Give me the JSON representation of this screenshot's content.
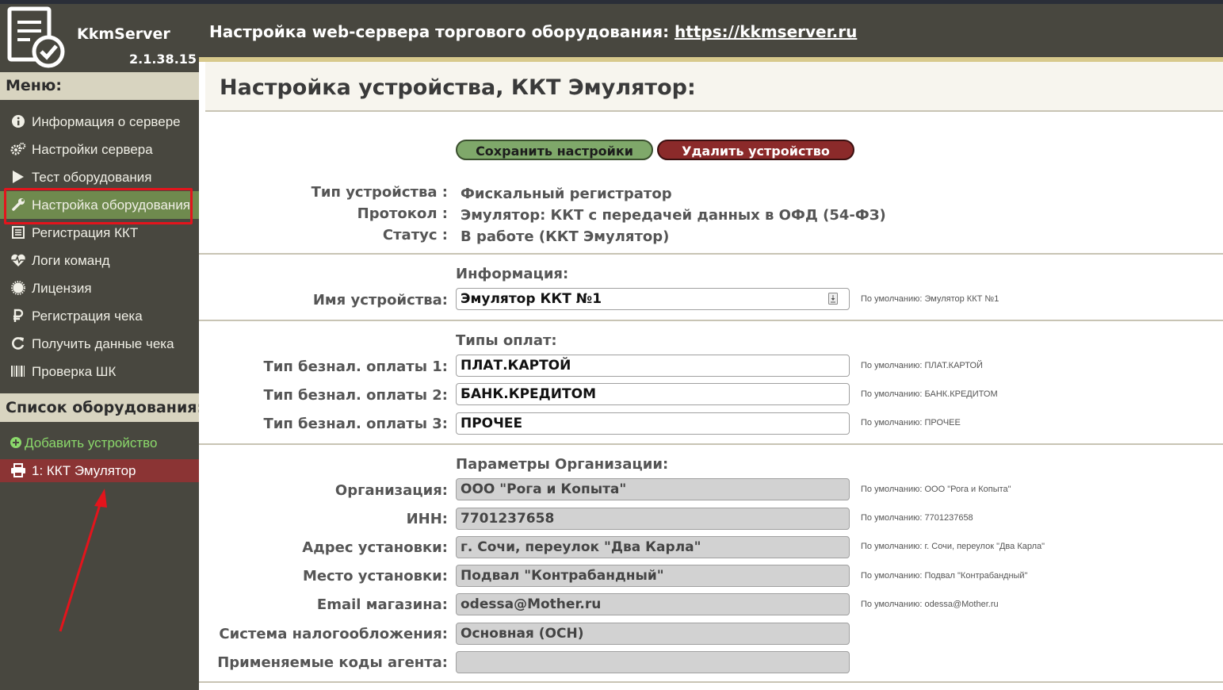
{
  "app": {
    "name": "KkmServer",
    "version": "2.1.38.15"
  },
  "header": {
    "title": "Настройка web-сервера торгового оборудования: ",
    "link": "https://kkmserver.ru"
  },
  "sidebar": {
    "menu_header": "Меню:",
    "items": [
      {
        "label": "Информация о сервере",
        "icon": "info-icon"
      },
      {
        "label": "Настройки сервера",
        "icon": "gears-icon"
      },
      {
        "label": "Тест оборудования",
        "icon": "play-icon"
      },
      {
        "label": "Настройка оборудования",
        "icon": "wrench-icon"
      },
      {
        "label": "Регистрация ККТ",
        "icon": "list-icon"
      },
      {
        "label": "Логи команд",
        "icon": "heartbeat-icon"
      },
      {
        "label": "Лицензия",
        "icon": "certificate-icon"
      },
      {
        "label": "Регистрация чека",
        "icon": "ruble-icon"
      },
      {
        "label": "Получить данные чека",
        "icon": "refresh-icon"
      },
      {
        "label": "Проверка ШК",
        "icon": "barcode-icon"
      }
    ],
    "equipment_header": "Список оборудования:",
    "add_device": "Добавить устройство",
    "device": "1: ККТ Эмулятор"
  },
  "page": {
    "title": "Настройка устройства, ККТ Эмулятор:",
    "save_button": "Сохранить настройки",
    "delete_button": "Удалить устройство",
    "device_info": {
      "type_label": "Тип устройства :",
      "type_value": "Фискальный регистратор",
      "protocol_label": "Протокол :",
      "protocol_value": "Эмулятор: ККТ с передачей данных в ОФД (54-ФЗ)",
      "status_label": "Статус :",
      "status_value": "В работе (ККТ Эмулятор)"
    },
    "info_section": {
      "title": "Информация:",
      "name_label": "Имя устройства:",
      "name_value": "Эмулятор ККТ №1",
      "name_hint": "По умолчанию: Эмулятор ККТ №1"
    },
    "payment_section": {
      "title": "Типы оплат:",
      "rows": [
        {
          "label": "Тип безнал. оплаты 1:",
          "value": "ПЛАТ.КАРТОЙ",
          "hint": "По умолчанию: ПЛАТ.КАРТОЙ"
        },
        {
          "label": "Тип безнал. оплаты 2:",
          "value": "БАНК.КРЕДИТОМ",
          "hint": "По умолчанию: БАНК.КРЕДИТОМ"
        },
        {
          "label": "Тип безнал. оплаты 3:",
          "value": "ПРОЧЕЕ",
          "hint": "По умолчанию: ПРОЧЕЕ"
        }
      ]
    },
    "org_section": {
      "title": "Параметры Организации:",
      "rows": [
        {
          "label": "Организация:",
          "value": "ООО \"Рога и Копыта\"",
          "hint": "По умолчанию: ООО \"Рога и Копыта\""
        },
        {
          "label": "ИНН:",
          "value": "7701237658",
          "hint": "По умолчанию: 7701237658"
        },
        {
          "label": "Адрес установки:",
          "value": "г. Сочи, переулок \"Два Карла\"",
          "hint": "По умолчанию: г. Сочи, переулок \"Два Карла\""
        },
        {
          "label": "Место установки:",
          "value": "Подвал \"Контрабандный\"",
          "hint": "По умолчанию: Подвал \"Контрабандный\""
        },
        {
          "label": "Email магазина:",
          "value": "odessa@Mother.ru",
          "hint": "По умолчанию: odessa@Mother.ru"
        },
        {
          "label": "Система налогообложения:",
          "value": "Основная (ОСН)",
          "hint": ""
        },
        {
          "label": "Применяемые коды агента:",
          "value": "",
          "hint": ""
        }
      ]
    }
  },
  "colors": {
    "sidebar_bg": "#48473f",
    "active_item": "#6f8a4e",
    "device_item": "#8b3434",
    "save_btn": "#7fa86a",
    "delete_btn": "#8b2a2a",
    "annotation_red": "#e3141c"
  }
}
